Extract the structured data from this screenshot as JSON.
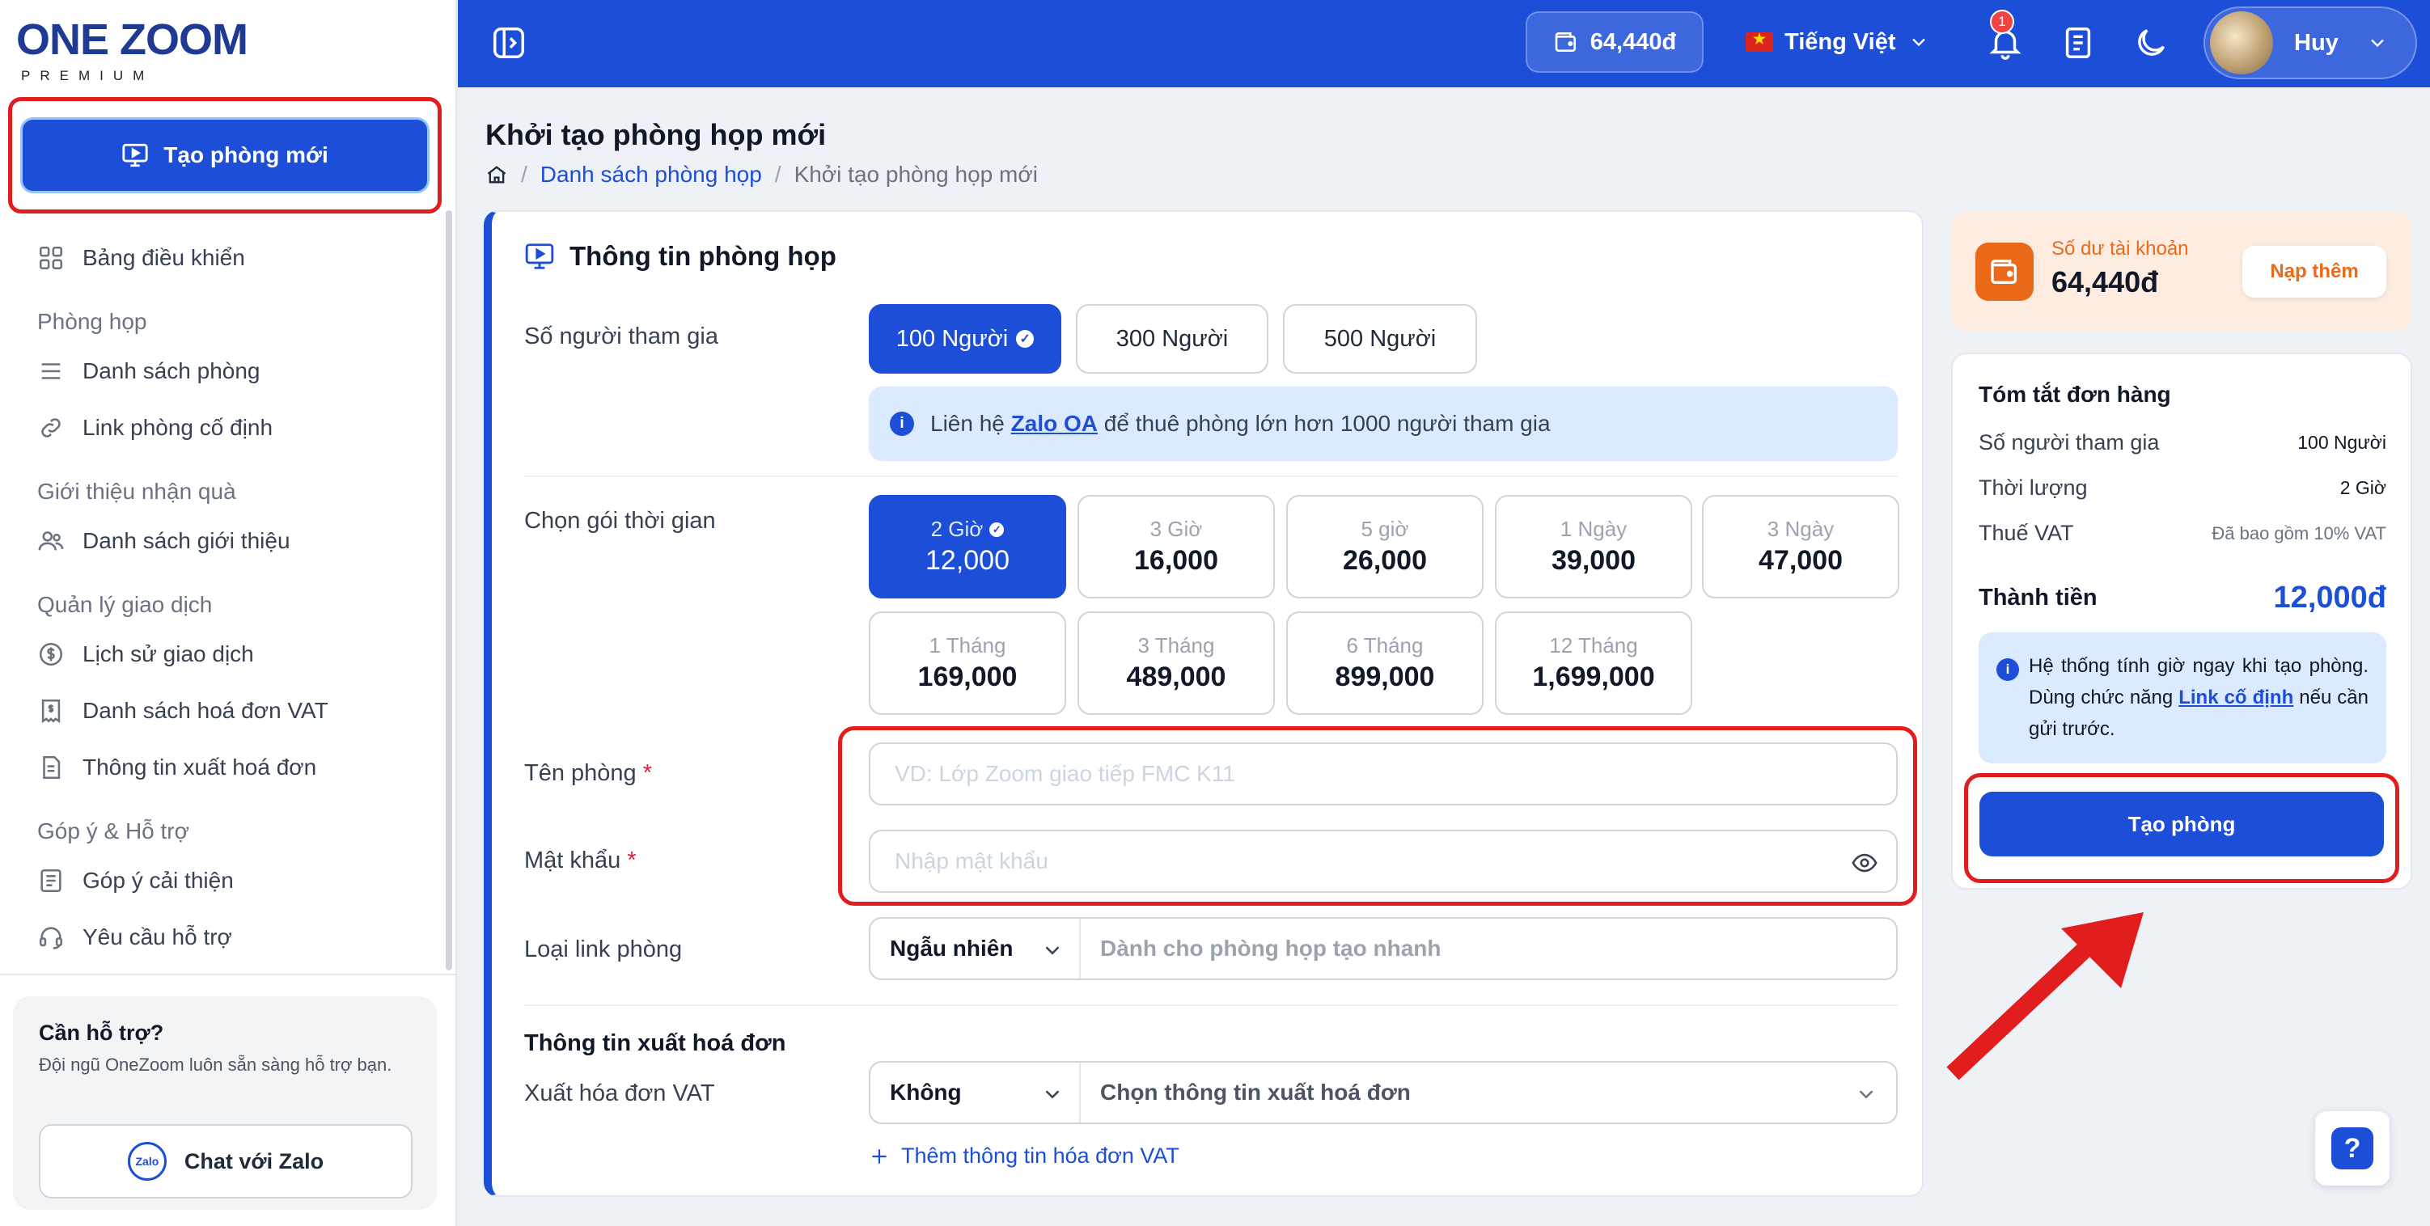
{
  "brand": {
    "name": "ONE ZOOM",
    "tagline": "PREMIUM"
  },
  "sidebar": {
    "new_room_label": "Tạo phòng mới",
    "dashboard": "Bảng điều khiển",
    "sections": [
      {
        "title": "Phòng họp",
        "items": [
          "Danh sách phòng",
          "Link phòng cố định"
        ]
      },
      {
        "title": "Giới thiệu nhận quà",
        "items": [
          "Danh sách giới thiệu"
        ]
      },
      {
        "title": "Quản lý giao dịch",
        "items": [
          "Lịch sử giao dịch",
          "Danh sách hoá đơn VAT",
          "Thông tin xuất hoá đơn"
        ]
      },
      {
        "title": "Góp ý & Hỗ trợ",
        "items": [
          "Góp ý cải thiện",
          "Yêu cầu hỗ trợ"
        ]
      }
    ],
    "help": {
      "title": "Cần hỗ trợ?",
      "desc": "Đội ngũ OneZoom luôn sẵn sàng hỗ trợ bạn.",
      "zalo_logo": "Zalo",
      "zalo_button": "Chat với Zalo"
    }
  },
  "topbar": {
    "wallet": "64,440đ",
    "language": "Tiếng Việt",
    "notification_count": "1",
    "user_name": "Huy"
  },
  "page": {
    "title": "Khởi tạo phòng họp mới",
    "breadcrumb": [
      "Danh sách phòng họp",
      "Khởi tạo phòng họp mới"
    ]
  },
  "form": {
    "card_title": "Thông tin phòng họp",
    "participants_label": "Số người tham gia",
    "participant_options": [
      "100 Người",
      "300 Người",
      "500 Người"
    ],
    "selected_participants": "100 Người",
    "info_prefix": "Liên hệ",
    "info_link": "Zalo OA",
    "info_suffix": "để thuê phòng lớn hơn 1000 người tham gia",
    "plan_label": "Chọn gói thời gian",
    "plans": [
      {
        "duration": "2 Giờ",
        "price": "12,000",
        "selected": true
      },
      {
        "duration": "3 Giờ",
        "price": "16,000"
      },
      {
        "duration": "5 giờ",
        "price": "26,000"
      },
      {
        "duration": "1 Ngày",
        "price": "39,000"
      },
      {
        "duration": "3 Ngày",
        "price": "47,000"
      },
      {
        "duration": "1 Tháng",
        "price": "169,000"
      },
      {
        "duration": "3 Tháng",
        "price": "489,000"
      },
      {
        "duration": "6 Tháng",
        "price": "899,000"
      },
      {
        "duration": "12 Tháng",
        "price": "1,699,000"
      }
    ],
    "room_name_label": "Tên phòng",
    "room_name_placeholder": "VD: Lớp Zoom giao tiếp FMC K11",
    "password_label": "Mật khẩu",
    "password_placeholder": "Nhập mật khẩu",
    "required_mark": "*",
    "link_type_label": "Loại link phòng",
    "link_type_value": "Ngẫu nhiên",
    "link_type_hint": "Dành cho phòng họp tạo nhanh",
    "invoice_section": "Thông tin xuất hoá đơn",
    "vat_label": "Xuất hóa đơn VAT",
    "vat_value": "Không",
    "vat_info_placeholder": "Chọn thông tin xuất hoá đơn",
    "add_invoice_link": "Thêm thông tin hóa đơn VAT"
  },
  "balance": {
    "label": "Số dư tài khoản",
    "value": "64,440đ",
    "topup": "Nạp thêm"
  },
  "order": {
    "title": "Tóm tắt đơn hàng",
    "rows": [
      {
        "key": "Số người tham gia",
        "value": "100 Người"
      },
      {
        "key": "Thời lượng",
        "value": "2 Giờ"
      },
      {
        "key": "Thuế VAT",
        "value": "Đã bao gồm 10% VAT"
      }
    ],
    "total_label": "Thành tiền",
    "total_value": "12,000đ",
    "note_before": "Hệ thống tính giờ ngay khi tạo phòng. Dùng chức năng",
    "note_link": "Link cố định",
    "note_after": "nếu cần gửi trước.",
    "create_button": "Tạo phòng"
  },
  "colors": {
    "primary": "#1d4ed8",
    "highlight": "#e11d1d",
    "balance_accent": "#ea6a1a"
  },
  "icons": [
    "monitor-play-icon",
    "dashboard-grid-icon",
    "list-icon",
    "link-icon",
    "users-icon",
    "dollar-circle-icon",
    "receipt-icon",
    "document-icon",
    "feedback-icon",
    "headset-icon",
    "wallet-icon",
    "bell-icon",
    "book-icon",
    "moon-icon",
    "chevron-down-icon",
    "eye-icon",
    "plus-icon",
    "home-icon",
    "info-icon",
    "question-icon"
  ]
}
